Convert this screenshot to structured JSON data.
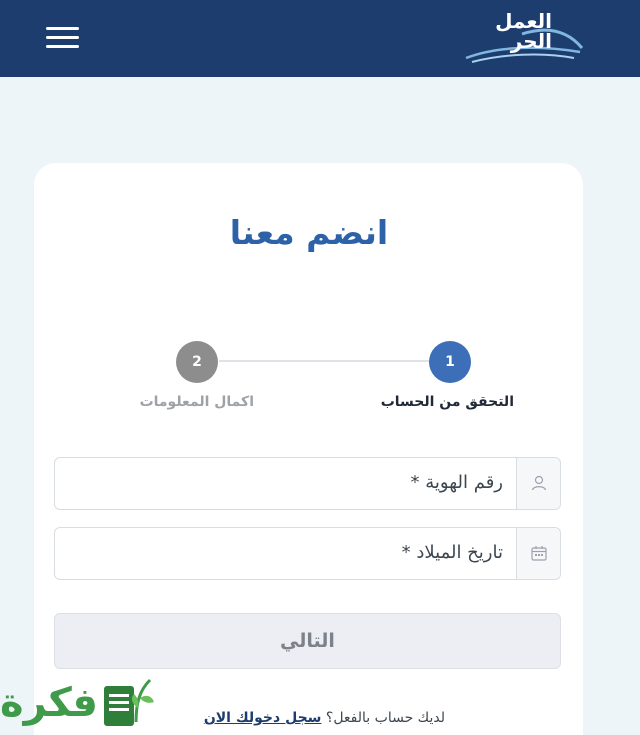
{
  "header": {
    "menu_icon": "hamburger-menu-icon",
    "logo_text_line1": "العمل",
    "logo_text_line2": "الحر",
    "background_color": "#1d3d6e"
  },
  "form": {
    "title": "انضم معنا",
    "steps": [
      {
        "number": "1",
        "label": "التحقق من الحساب",
        "state": "active"
      },
      {
        "number": "2",
        "label": "اكمال المعلومات",
        "state": "inactive"
      }
    ],
    "fields": [
      {
        "label": "رقم الهوية *",
        "icon": "user-icon"
      },
      {
        "label": "تاريخ الميلاد *",
        "icon": "calendar-icon"
      }
    ],
    "next_button_label": "التالي",
    "login_prompt": "لديك حساب بالفعل؟",
    "login_link": "سجل دخولك الان"
  },
  "watermark": {
    "text": "فكرة"
  },
  "colors": {
    "accent": "#3d6fb8",
    "title": "#2e62a8",
    "inactive_step": "#8d8d8d",
    "page_background": "#eef5f8"
  }
}
